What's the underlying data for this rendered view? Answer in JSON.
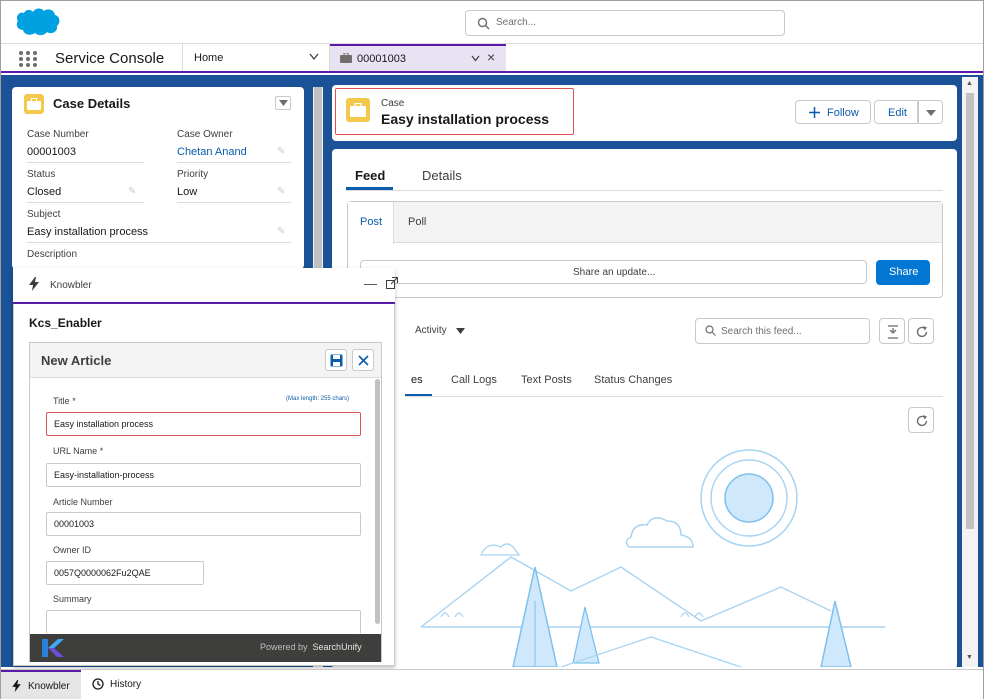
{
  "header": {
    "search_placeholder": "Search..."
  },
  "nav": {
    "app_name": "Service Console",
    "home_tab": "Home",
    "case_tab": "00001003"
  },
  "case_details": {
    "title": "Case Details",
    "fields": {
      "case_number": {
        "label": "Case Number",
        "value": "00001003"
      },
      "case_owner": {
        "label": "Case Owner",
        "value": "Chetan Anand"
      },
      "status": {
        "label": "Status",
        "value": "Closed"
      },
      "priority": {
        "label": "Priority",
        "value": "Low"
      },
      "subject": {
        "label": "Subject",
        "value": "Easy installation process"
      },
      "description": {
        "label": "Description"
      }
    }
  },
  "record_header": {
    "object_label": "Case",
    "title": "Easy installation process",
    "follow_label": "Follow",
    "edit_label": "Edit"
  },
  "record_tabs": {
    "feed": "Feed",
    "details": "Details"
  },
  "publisher": {
    "post_tab": "Post",
    "poll_tab": "Poll",
    "share_placeholder": "Share an update...",
    "share_button": "Share"
  },
  "feed": {
    "filter_label": "Activity",
    "search_placeholder": "Search this feed...",
    "tabs": {
      "updates_partial": "es",
      "call_logs": "Call Logs",
      "text_posts": "Text Posts",
      "status_changes": "Status Changes"
    }
  },
  "knowbler": {
    "header_label": "Knowbler",
    "panel_title": "Kcs_Enabler",
    "form_title": "New Article",
    "fields": {
      "title": {
        "label": "Title",
        "hint": "(Max length: 255 chars)",
        "value": "Easy installation process"
      },
      "url_name": {
        "label": "URL Name",
        "value": "Easy-installation-process"
      },
      "article_number": {
        "label": "Article Number",
        "value": "00001003"
      },
      "owner_id": {
        "label": "Owner ID",
        "value": "0057Q0000062Fu2QAE"
      },
      "summary": {
        "label": "Summary"
      }
    },
    "required_mark": "*",
    "powered_by": "Powered by",
    "brand": "SearchUnify"
  },
  "utility_bar": {
    "knowbler": "Knowbler",
    "history": "History"
  },
  "colors": {
    "brand_blue": "#0176d3",
    "console_purple": "#5a1ba9",
    "workspace_bg": "#1b5297",
    "case_yellow": "#f2c94c",
    "highlight_red": "#e05252"
  }
}
